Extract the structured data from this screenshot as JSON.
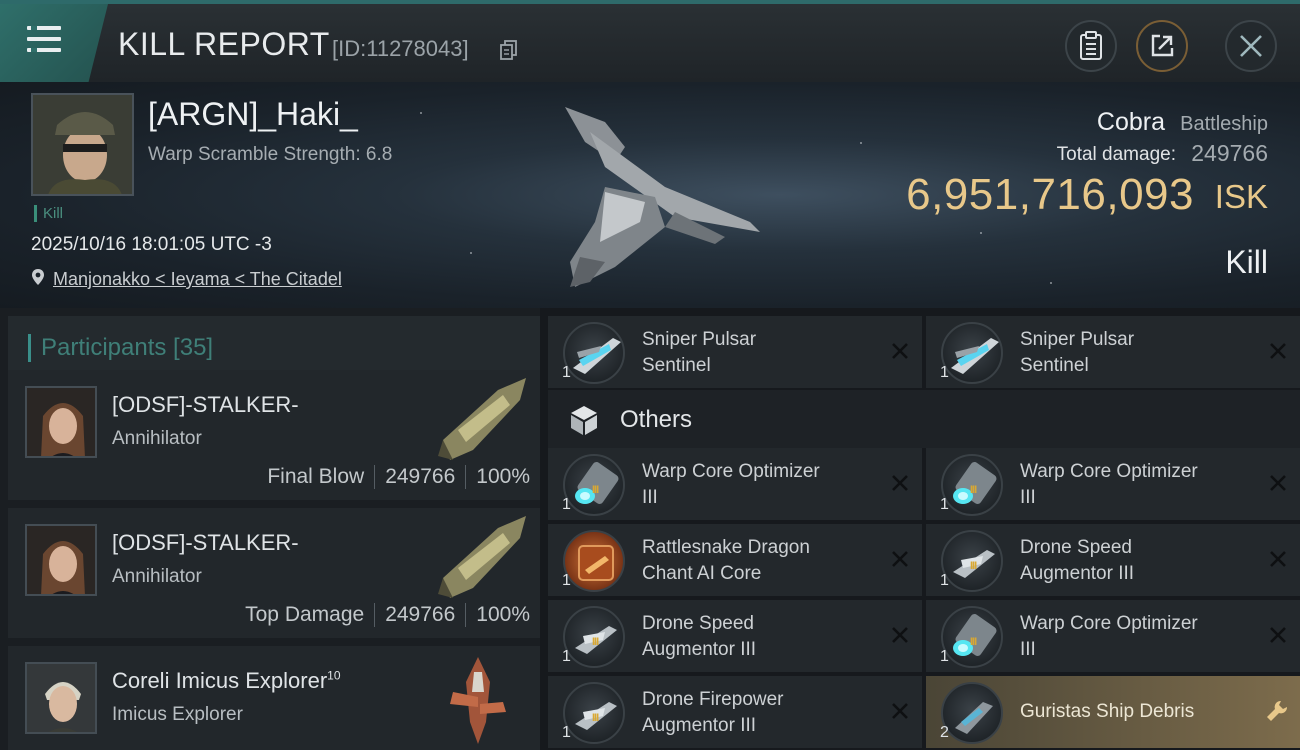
{
  "header": {
    "title": "KILL REPORT",
    "report_id": "[ID:11278043]"
  },
  "victim": {
    "pilot_name": "[ARGN]_Haki_",
    "warp_scramble": "Warp Scramble Strength: 6.8",
    "kill_tag": "Kill",
    "timestamp": "2025/10/16 18:01:05 UTC -3",
    "location": "Manjonakko < Ieyama < The Citadel",
    "ship_name": "Cobra",
    "ship_class": "Battleship",
    "total_damage_label": "Total damage:",
    "total_damage": "249766",
    "isk_value": "6,951,716,093",
    "isk_unit": "ISK",
    "result": "Kill"
  },
  "participants": {
    "title": "Participants [35]",
    "rows": [
      {
        "name": "[ODSF]-STALKER-",
        "sup": "",
        "ship": "Annihilator",
        "role": "Final Blow",
        "damage": "249766",
        "percent": "100%"
      },
      {
        "name": "[ODSF]-STALKER-",
        "sup": "",
        "ship": "Annihilator",
        "role": "Top Damage",
        "damage": "249766",
        "percent": "100%"
      },
      {
        "name": "Coreli Imicus Explorer",
        "sup": "10",
        "ship": "Imicus Explorer",
        "role": "",
        "damage": "",
        "percent": ""
      }
    ]
  },
  "items": {
    "others_label": "Others",
    "top_row": [
      {
        "qty": "1",
        "name_line1": "Sniper Pulsar",
        "name_line2": "Sentinel",
        "icon": "drone-icon"
      },
      {
        "qty": "1",
        "name_line1": "Sniper Pulsar",
        "name_line2": "Sentinel",
        "icon": "drone-icon"
      }
    ],
    "others": [
      {
        "qty": "1",
        "name_line1": "Warp Core Optimizer",
        "name_line2": "III",
        "icon": "warp-core-icon",
        "tier": "III"
      },
      {
        "qty": "1",
        "name_line1": "Warp Core Optimizer",
        "name_line2": "III",
        "icon": "warp-core-icon",
        "tier": "III"
      },
      {
        "qty": "1",
        "name_line1": "Rattlesnake Dragon",
        "name_line2": "Chant AI Core",
        "icon": "ai-core-icon",
        "tier": ""
      },
      {
        "qty": "1",
        "name_line1": "Drone Speed",
        "name_line2": "Augmentor III",
        "icon": "drone-augmentor-icon",
        "tier": "III"
      },
      {
        "qty": "1",
        "name_line1": "Drone Speed",
        "name_line2": "Augmentor III",
        "icon": "drone-augmentor-icon",
        "tier": "III"
      },
      {
        "qty": "1",
        "name_line1": "Warp Core Optimizer",
        "name_line2": "III",
        "icon": "warp-core-icon",
        "tier": "III"
      },
      {
        "qty": "1",
        "name_line1": "Drone Firepower",
        "name_line2": "Augmentor III",
        "icon": "drone-augmentor-icon",
        "tier": "III"
      },
      {
        "qty": "2",
        "name_line1": "Guristas Ship Debris",
        "name_line2": "",
        "icon": "debris-icon",
        "tier": ""
      }
    ]
  },
  "colors": {
    "accent_teal": "#2f6f6a",
    "isk_gold": "#e8c88a",
    "highlight_gold": "#7d6c4c"
  }
}
